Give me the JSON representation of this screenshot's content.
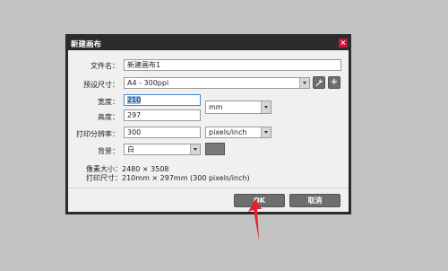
{
  "dialog": {
    "title": "新建画布",
    "close_label": "×"
  },
  "form": {
    "filename_label": "文件名：",
    "filename_value": "新建画布1",
    "preset_label": "预设尺寸：",
    "preset_value": "A4 - 300ppi",
    "width_label": "宽度：",
    "width_value": "210",
    "height_label": "高度：",
    "height_value": "297",
    "unit_value": "mm",
    "resolution_label": "打印分辨率：",
    "resolution_value": "300",
    "resolution_unit_value": "pixels/inch",
    "background_label": "背景：",
    "background_value": "白"
  },
  "info": {
    "pixel_size_label": "像素大小：",
    "pixel_size_value": "2480 × 3508",
    "print_size_label": "打印尺寸：",
    "print_size_value": "210mm × 297mm (300 pixels/inch)"
  },
  "buttons": {
    "ok_label": "OK",
    "cancel_label": "取消"
  },
  "icons": {
    "wrench": "wrench-icon",
    "plus": "plus-icon",
    "arrow": "red-arrow-annotation"
  },
  "colors": {
    "titlebar": "#2b2b2b",
    "close": "#c8153a",
    "button": "#6e6e6e",
    "arrow": "#e8212b",
    "background_swatch": "#7a7a7a"
  }
}
